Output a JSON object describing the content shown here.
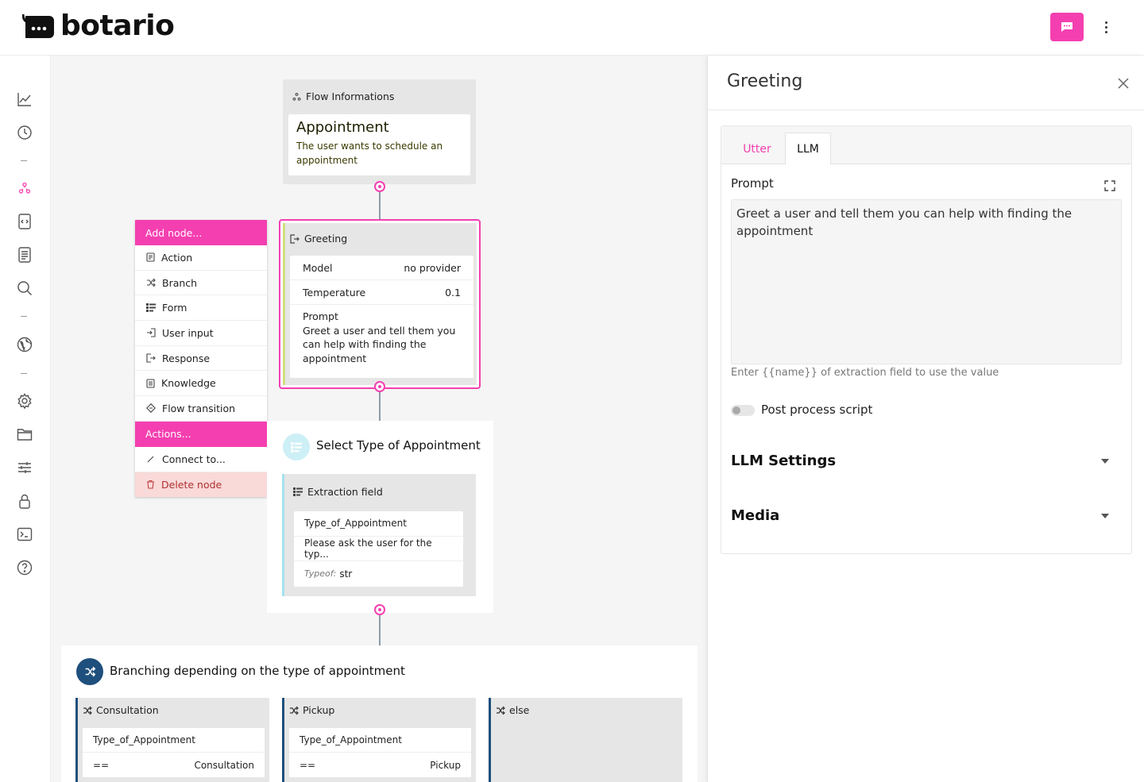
{
  "app": {
    "brand": "botario"
  },
  "header": {
    "chat_icon": "chat-icon",
    "menu_icon": "kebab-icon",
    "accent": "#f43fb0"
  },
  "sidebar": {
    "items": [
      "analytics-icon",
      "history-icon",
      "flows-icon",
      "code-icon",
      "document-icon",
      "search-icon",
      "globe-icon",
      "settings-icon",
      "folder-icon",
      "sliders-icon",
      "lock-icon",
      "terminal-icon",
      "help-icon"
    ]
  },
  "flow_info": {
    "heading": "Flow Informations",
    "name": "Appointment",
    "description": "The user wants to schedule an appointment"
  },
  "greeting_node": {
    "heading": "Greeting",
    "model_label": "Model",
    "model_value": "no provider",
    "temperature_label": "Temperature",
    "temperature_value": "0.1",
    "prompt_label": "Prompt",
    "prompt_text": "Greet a user and tell them you can help with finding the appointment"
  },
  "context_menu": {
    "add_header": "Add node...",
    "add_items": [
      "Action",
      "Branch",
      "Form",
      "User input",
      "Response",
      "Knowledge",
      "Flow transition"
    ],
    "actions_header": "Actions...",
    "connect": "Connect to...",
    "delete": "Delete node"
  },
  "select_node": {
    "title": "Select Type of Appointment",
    "field_heading": "Extraction field",
    "field_name": "Type_of_Appointment",
    "field_prompt": "Please ask the user for the typ...",
    "type_label": "Typeof:",
    "type_value": "str"
  },
  "branch_node": {
    "title": "Branching depending on the type of appointment",
    "branches": [
      {
        "name": "Consultation",
        "field": "Type_of_Appointment",
        "op": "==",
        "value": "Consultation"
      },
      {
        "name": "Pickup",
        "field": "Type_of_Appointment",
        "op": "==",
        "value": "Pickup"
      },
      {
        "name": "else"
      }
    ]
  },
  "panel": {
    "title": "Greeting",
    "tabs": [
      "Utter",
      "LLM"
    ],
    "active_tab": "LLM",
    "prompt_label": "Prompt",
    "prompt_value": "Greet a user and tell them you can help with finding the appointment",
    "hint": "Enter {{name}} of extraction field to use the value",
    "post_process_label": "Post process script",
    "post_process_enabled": false,
    "llm_settings": "LLM Settings",
    "media": "Media"
  }
}
